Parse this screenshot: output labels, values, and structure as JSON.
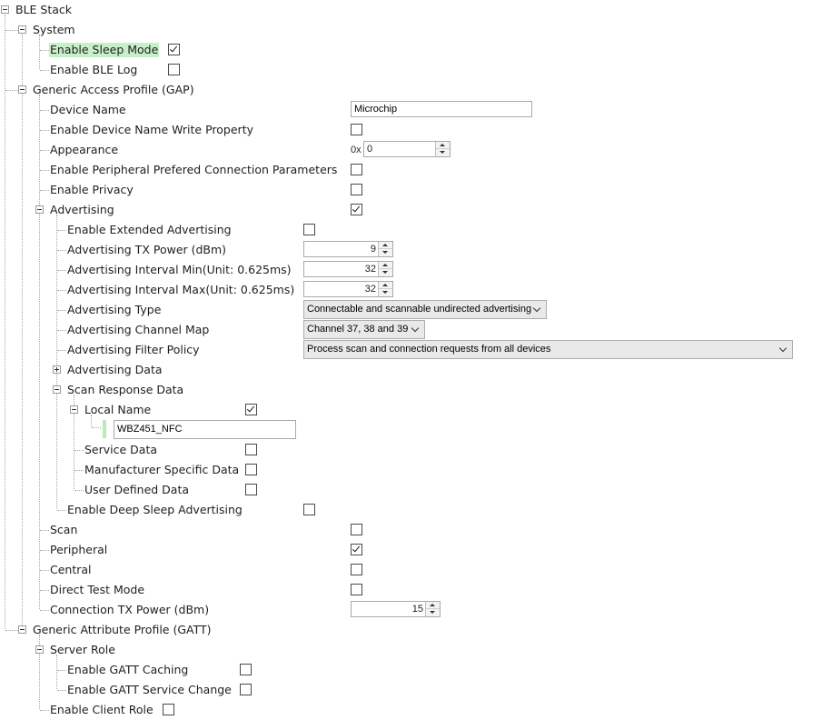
{
  "tree": {
    "ble_stack": "BLE Stack",
    "system": "System",
    "enable_sleep_mode": "Enable Sleep Mode",
    "enable_ble_log": "Enable BLE Log",
    "gap": "Generic Access Profile (GAP)",
    "device_name": "Device Name",
    "device_name_value": "Microchip",
    "enable_device_name_write": "Enable Device Name Write Property",
    "appearance": "Appearance",
    "appearance_prefix": "0x",
    "appearance_value": "0",
    "enable_peripheral_pref": "Enable Peripheral Prefered Connection Parameters",
    "enable_privacy": "Enable Privacy",
    "advertising": "Advertising",
    "enable_extended_adv": "Enable Extended Advertising",
    "adv_tx_power": "Advertising TX Power (dBm)",
    "adv_tx_power_value": "9",
    "adv_interval_min": "Advertising Interval Min(Unit: 0.625ms)",
    "adv_interval_min_value": "32",
    "adv_interval_max": "Advertising Interval Max(Unit: 0.625ms)",
    "adv_interval_max_value": "32",
    "adv_type": "Advertising Type",
    "adv_type_value": "Connectable and scannable undirected advertising",
    "adv_channel_map": "Advertising Channel Map",
    "adv_channel_map_value": "Channel 37, 38 and 39",
    "adv_filter_policy": "Advertising Filter Policy",
    "adv_filter_policy_value": "Process scan and connection requests from all devices",
    "adv_data": "Advertising Data",
    "scan_response_data": "Scan Response Data",
    "local_name": "Local Name",
    "local_name_value": "WBZ451_NFC",
    "service_data": "Service Data",
    "manufacturer_data": "Manufacturer Specific Data",
    "user_defined_data": "User Defined Data",
    "enable_deep_sleep_adv": "Enable Deep Sleep Advertising",
    "scan": "Scan",
    "peripheral": "Peripheral",
    "central": "Central",
    "direct_test_mode": "Direct Test Mode",
    "conn_tx_power": "Connection TX Power (dBm)",
    "conn_tx_power_value": "15",
    "gatt": "Generic Attribute Profile (GATT)",
    "server_role": "Server Role",
    "enable_gatt_caching": "Enable GATT Caching",
    "enable_gatt_service_change": "Enable GATT Service Change",
    "enable_client_role": "Enable Client Role"
  },
  "checks": {
    "enable_sleep_mode": true,
    "enable_ble_log": false,
    "enable_device_name_write": false,
    "enable_peripheral_pref": false,
    "enable_privacy": false,
    "advertising": true,
    "enable_extended_adv": false,
    "local_name": true,
    "service_data": false,
    "manufacturer_data": false,
    "user_defined_data": false,
    "enable_deep_sleep_adv": false,
    "scan": false,
    "peripheral": true,
    "central": false,
    "direct_test_mode": false,
    "enable_gatt_caching": false,
    "enable_gatt_service_change": false,
    "enable_client_role": false
  },
  "colors": {
    "selection": "#c8f0c8",
    "tree_lines": "#a8a8a8"
  }
}
